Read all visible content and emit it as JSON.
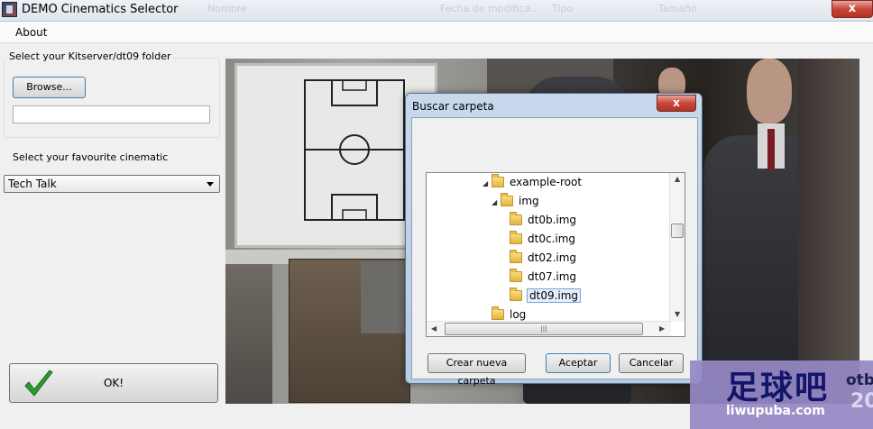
{
  "window": {
    "title": "DEMO Cinematics Selector",
    "close_glyph": "x"
  },
  "background_ghost_headers": [
    "Nombre",
    "Fecha de modifica...",
    "Tipo",
    "Tamaño"
  ],
  "menu": {
    "about": "About"
  },
  "left_panel": {
    "folder_group_label": "Select your Kitserver/dt09 folder",
    "browse_label": "Browse...",
    "path_value": "",
    "cinematic_label": "Select your favourite cinematic",
    "cinematic_selected": "Tech Talk",
    "ok_label": "OK!"
  },
  "dialog": {
    "title": "Buscar carpeta",
    "close_glyph": "x",
    "tree": [
      {
        "label": "example-root",
        "expanded": true,
        "selected": false
      },
      {
        "label": "img",
        "expanded": true,
        "selected": false
      },
      {
        "label": "dt0b.img",
        "expanded": false,
        "selected": false
      },
      {
        "label": "dt0c.img",
        "expanded": false,
        "selected": false
      },
      {
        "label": "dt02.img",
        "expanded": false,
        "selected": false
      },
      {
        "label": "dt07.img",
        "expanded": false,
        "selected": false
      },
      {
        "label": "dt09.img",
        "expanded": false,
        "selected": true
      },
      {
        "label": "log",
        "expanded": false,
        "selected": false
      }
    ],
    "new_folder_label": "Crear nueva carpeta",
    "accept_label": "Aceptar",
    "cancel_label": "Cancelar"
  },
  "watermark": {
    "text": "足球吧",
    "url": "liwupuba.com",
    "side_text": "otb",
    "side_text2": "20"
  },
  "colors": {
    "accent": "#3c7fb1",
    "close_red": "#c7463a",
    "check_green": "#2e9b2e"
  }
}
